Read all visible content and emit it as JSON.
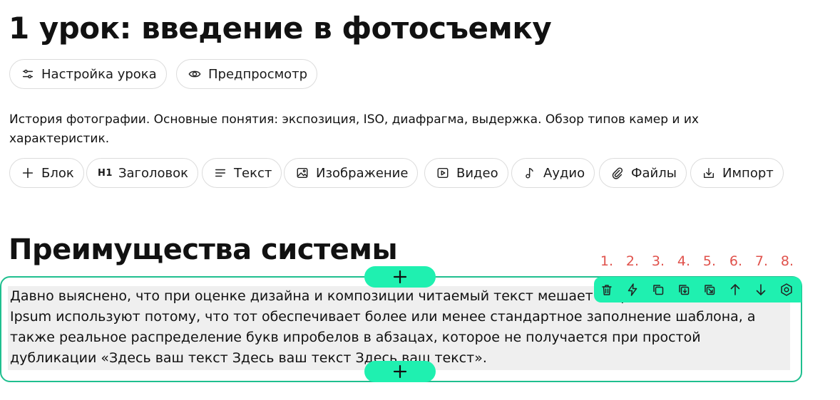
{
  "page": {
    "title": "1 урок: введение в фотосъемку"
  },
  "lesson_actions": [
    {
      "label": "Настройка урока",
      "icon": "sliders-icon"
    },
    {
      "label": "Предпросмотр",
      "icon": "eye-icon"
    }
  ],
  "description": "История фотографии. Основные понятия: экспозиция, ISO, диафрагма, выдержка. Обзор типов камер и их характеристик.",
  "insert_toolbar": [
    {
      "label": "Блок",
      "icon": "plus-icon"
    },
    {
      "label": "Заголовок",
      "icon": "h1-icon",
      "glyph": "H1"
    },
    {
      "label": "Текст",
      "icon": "lines-icon"
    },
    {
      "label": "Изображение",
      "icon": "image-icon"
    },
    {
      "label": "Видео",
      "icon": "video-icon"
    },
    {
      "label": "Аудио",
      "icon": "music-note-icon"
    },
    {
      "label": "Файлы",
      "icon": "paperclip-icon"
    },
    {
      "label": "Импорт",
      "icon": "import-icon"
    }
  ],
  "section": {
    "heading": "Преимущества системы"
  },
  "block": {
    "text": "Давно выяснено, что при оценке дизайна и композиции читаемый текст мешает сосредоточиться. Lorem Ipsum используют потому, что тот обеспечивает более или менее стандартное заполнение шаблона, а также реальное распределение букв ипробелов в абзацах, которое не получается при простой дубликации «Здесь ваш текст Здесь ваш текст Здесь ваш текст»."
  },
  "block_toolbar": {
    "numbers": [
      "1.",
      "2.",
      "3.",
      "4.",
      "5.",
      "6.",
      "7.",
      "8."
    ],
    "tools": [
      "trash-icon",
      "lightning-icon",
      "copy-icon",
      "duplicate-icon",
      "move-icon",
      "arrow-up-icon",
      "arrow-down-icon",
      "settings-icon"
    ]
  },
  "colors": {
    "accent": "#1ff0b0",
    "frame": "#1fbf8f",
    "annotation": "#e0524c",
    "text_bg": "#efefef"
  }
}
